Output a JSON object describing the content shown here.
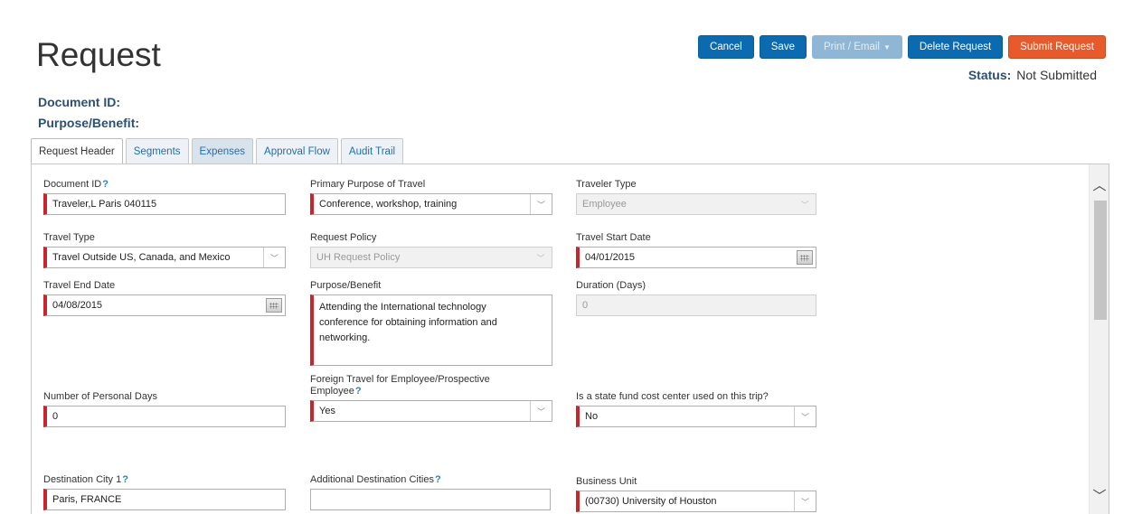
{
  "page": {
    "title": "Request"
  },
  "actions": {
    "cancel": "Cancel",
    "save": "Save",
    "print_email": "Print / Email",
    "delete": "Delete Request",
    "submit": "Submit Request"
  },
  "status": {
    "label": "Status:",
    "value": "Not Submitted"
  },
  "meta": {
    "document_id_label": "Document ID:",
    "purpose_label": "Purpose/Benefit:"
  },
  "tabs": [
    "Request Header",
    "Segments",
    "Expenses",
    "Approval Flow",
    "Audit Trail"
  ],
  "fields": {
    "document_id": {
      "label": "Document ID",
      "help": "?",
      "value": "Traveler,L Paris 040115"
    },
    "primary_purpose": {
      "label": "Primary Purpose of Travel",
      "value": "Conference, workshop, training"
    },
    "traveler_type": {
      "label": "Traveler Type",
      "value": "Employee"
    },
    "travel_type": {
      "label": "Travel Type",
      "value": "Travel Outside US, Canada, and Mexico"
    },
    "request_policy": {
      "label": "Request Policy",
      "value": "UH Request Policy"
    },
    "travel_start_date": {
      "label": "Travel Start Date",
      "value": "04/01/2015"
    },
    "travel_end_date": {
      "label": "Travel End Date",
      "value": "04/08/2015"
    },
    "purpose_benefit": {
      "label": "Purpose/Benefit",
      "value": "Attending the International technology conference for obtaining information and networking."
    },
    "duration_days": {
      "label": "Duration (Days)",
      "value": "0"
    },
    "personal_days": {
      "label": "Number of Personal Days",
      "value": "0"
    },
    "foreign_travel": {
      "label_line1": "Foreign Travel for Employee/Prospective",
      "label_line2": "Employee",
      "help": "?",
      "value": "Yes"
    },
    "state_fund": {
      "label": "Is a state fund cost center used on this trip?",
      "value": "No"
    },
    "destination_city": {
      "label": "Destination City 1",
      "help": "?",
      "value": "Paris, FRANCE"
    },
    "additional_cities": {
      "label": "Additional Destination Cities",
      "help": "?",
      "value": ""
    },
    "business_unit": {
      "label": "Business Unit",
      "value": "(00730) University of Houston"
    }
  },
  "icons": {
    "chevron": "chevron-down-icon",
    "calendar": "calendar-icon",
    "help": "help-cursor-icon"
  }
}
